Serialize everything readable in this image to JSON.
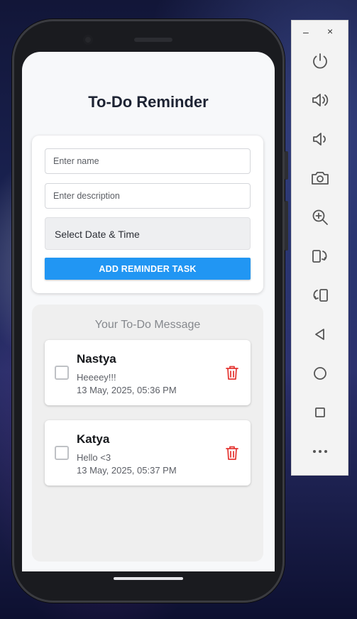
{
  "app": {
    "title": "To-Do Reminder"
  },
  "form": {
    "name_placeholder": "Enter name",
    "description_placeholder": "Enter description",
    "datetime_label": "Select Date & Time",
    "add_button_label": "ADD REMINDER TASK"
  },
  "list": {
    "title": "Your To-Do Message",
    "tasks": [
      {
        "name": "Nastya",
        "description": "Heeeey!!!",
        "date": "13 May, 2025, 05:36 PM",
        "checked": false
      },
      {
        "name": "Katya",
        "description": "Hello <3",
        "date": "13 May, 2025, 05:37 PM",
        "checked": false
      }
    ]
  },
  "toolbar": {
    "minimize": "–",
    "close": "×",
    "items": [
      "power-icon",
      "volume-up-icon",
      "volume-down-icon",
      "camera-icon",
      "zoom-icon",
      "rotate-left-icon",
      "rotate-right-icon",
      "back-icon",
      "home-icon",
      "overview-icon",
      "more-icon"
    ]
  },
  "colors": {
    "accent": "#2196f3",
    "delete": "#e53935",
    "title": "#1d2333"
  }
}
